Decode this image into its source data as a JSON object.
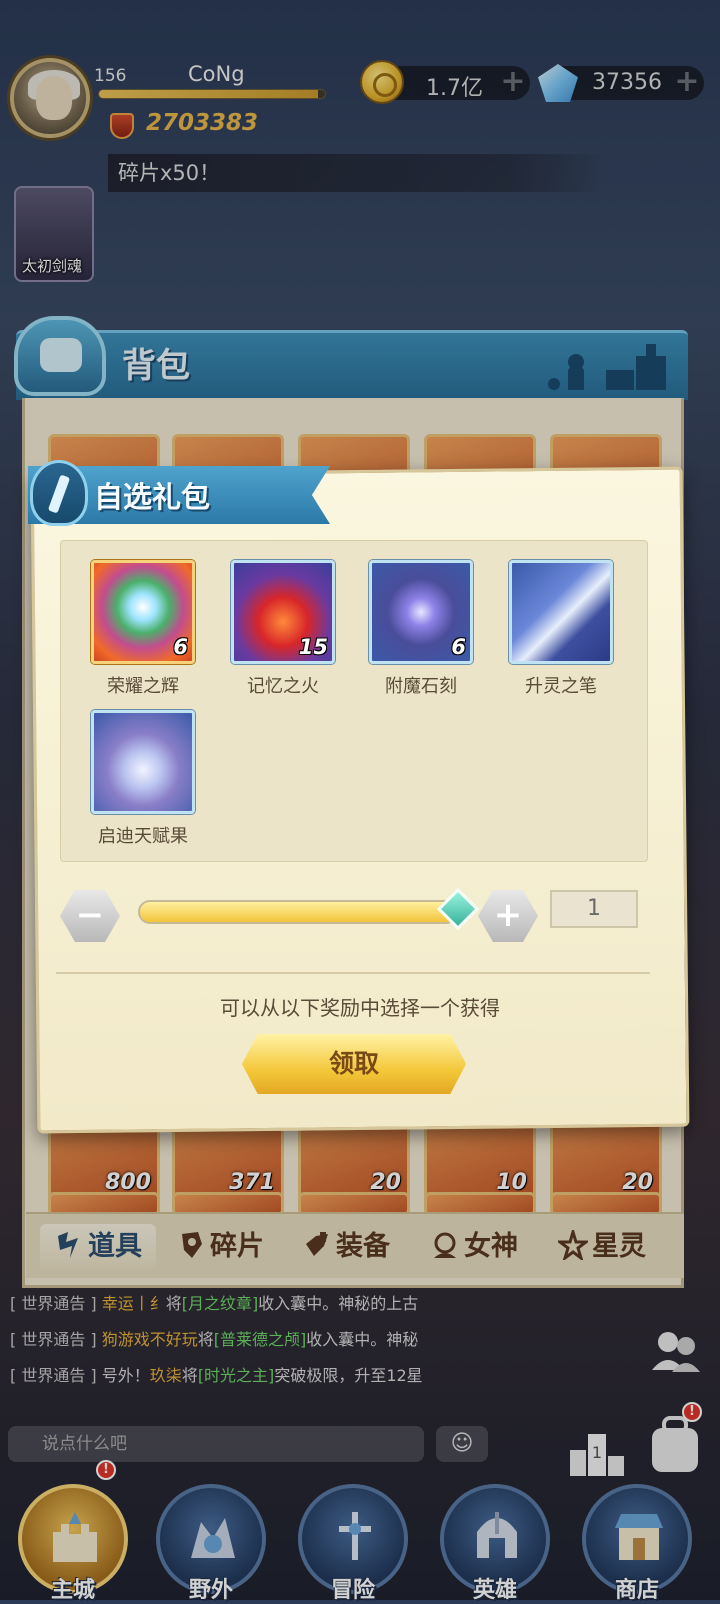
{
  "player": {
    "level": "156",
    "name": "CoNg",
    "exp_progress": 0.97,
    "power": "2703383"
  },
  "resources": {
    "gold": "1.7亿",
    "gems": "37356"
  },
  "ticker_text": "",
  "ticker_visible": "",
  "side_hero_label": "太初剑魂",
  "bag": {
    "title": "背包",
    "rows_bottom": [
      {
        "count": "800"
      },
      {
        "count": "371"
      },
      {
        "count": "20"
      },
      {
        "count": "10"
      },
      {
        "count": "20"
      }
    ],
    "tabs": [
      {
        "label": "道具",
        "icon": "props-icon",
        "active": true
      },
      {
        "label": "碎片",
        "icon": "fragment-icon",
        "active": false
      },
      {
        "label": "装备",
        "icon": "equipment-icon",
        "active": false
      },
      {
        "label": "女神",
        "icon": "goddess-icon",
        "active": false
      },
      {
        "label": "星灵",
        "icon": "star-spirit-icon",
        "active": false
      }
    ]
  },
  "dialog": {
    "title": "自选礼包",
    "rewards": [
      {
        "name": "荣耀之辉",
        "count": "6",
        "icon": "glory-orb-icon"
      },
      {
        "name": "记忆之火",
        "count": "15",
        "icon": "memory-flame-icon"
      },
      {
        "name": "附魔石刻",
        "count": "6",
        "icon": "enchant-rune-icon"
      },
      {
        "name": "升灵之笔",
        "count": "",
        "icon": "spirit-quill-icon"
      },
      {
        "name": "启迪天赋果",
        "count": "",
        "icon": "talent-fruit-icon"
      }
    ],
    "minus_label": "−",
    "plus_label": "+",
    "slider_value": 1.0,
    "quantity": "1",
    "hint": "可以从以下奖励中选择一个获得",
    "claim_label": "领取"
  },
  "chat": {
    "lines": [
      {
        "tag": "[ 世界通告 ]",
        "user": "幸运丨纟",
        "mid": "将",
        "item": "[月之纹章]",
        "tail": "收入囊中。神秘的上古"
      },
      {
        "tag": "[ 世界通告 ]",
        "user": "狗游戏不好玩",
        "mid": "将",
        "item": "[普莱德之颅]",
        "tail": "收入囊中。神秘"
      },
      {
        "tag": "[ 世界通告 ]",
        "user": "玖柒",
        "mid": "号外！",
        "item": "[时光之主]",
        "tail": "突破极限，升至12星"
      }
    ],
    "input_placeholder": "说点什么吧",
    "line3_prefix": "号外！",
    "line3_mid": "将"
  },
  "nav": [
    {
      "label": "主城",
      "active": true,
      "icon": "castle-icon"
    },
    {
      "label": "野外",
      "active": false,
      "icon": "wild-icon"
    },
    {
      "label": "冒险",
      "active": false,
      "icon": "adventure-icon"
    },
    {
      "label": "英雄",
      "active": false,
      "icon": "hero-helmet-icon"
    },
    {
      "label": "商店",
      "active": false,
      "icon": "shop-icon"
    }
  ],
  "colors": {
    "accent_blue": "#2c79a8",
    "gold": "#e7b64a",
    "chat_user": "#e9b23b",
    "chat_item": "#6fd66b"
  }
}
